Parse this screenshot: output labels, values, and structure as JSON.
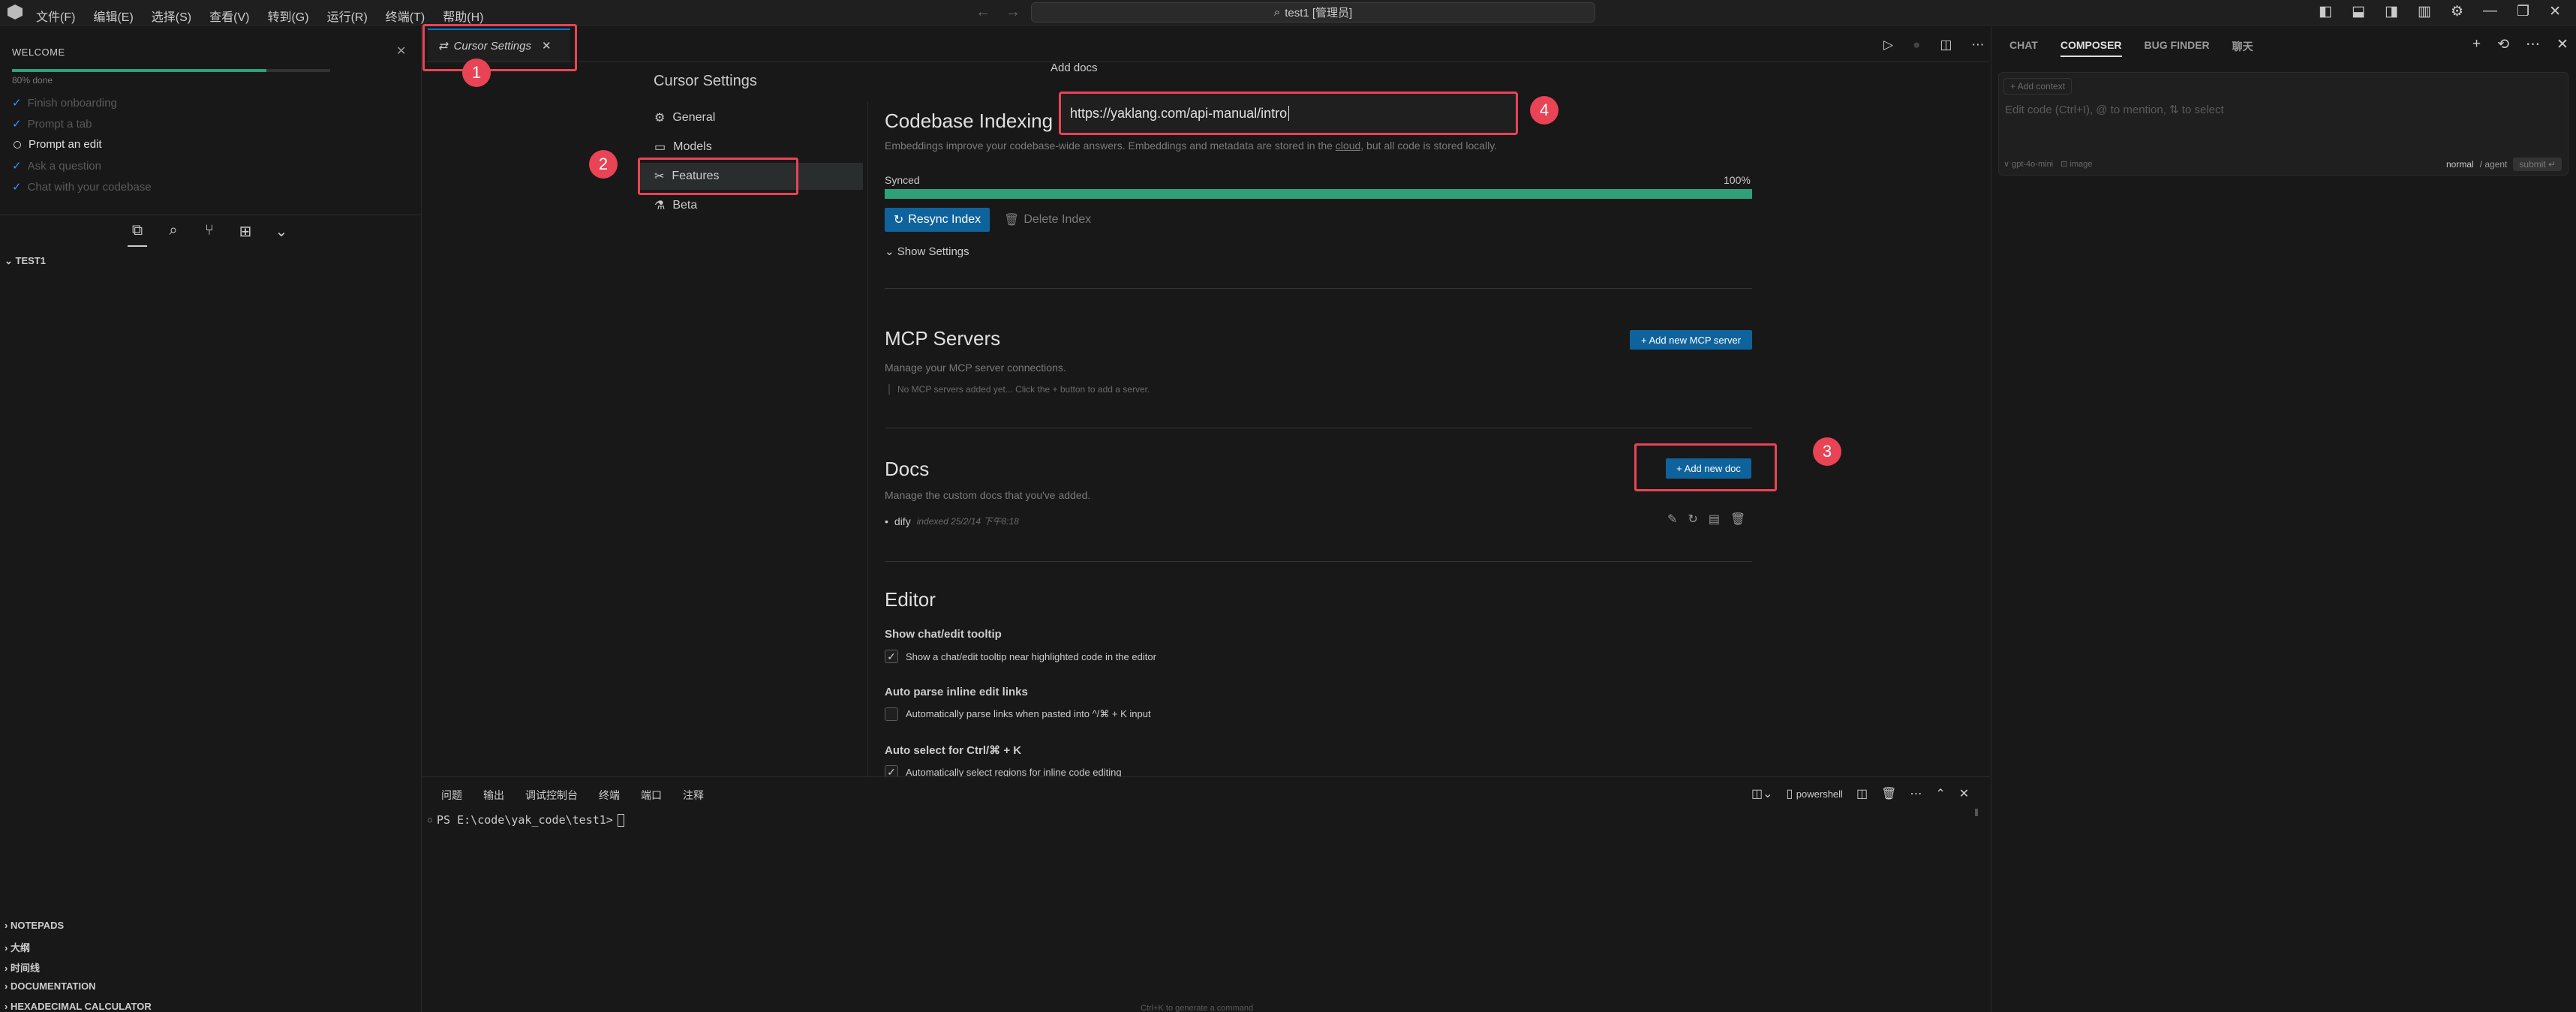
{
  "menu": [
    "文件(F)",
    "编辑(E)",
    "选择(S)",
    "查看(V)",
    "转到(G)",
    "运行(R)",
    "终端(T)",
    "帮助(H)"
  ],
  "command_center": {
    "label": "test1 [管理员]"
  },
  "welcome": {
    "title": "WELCOME",
    "progress_label": "80% done",
    "progress_fraction": 0.8,
    "steps": [
      {
        "label": "Finish onboarding",
        "done": true
      },
      {
        "label": "Prompt a tab",
        "done": true
      },
      {
        "label": "Prompt an edit",
        "done": false
      },
      {
        "label": "Ask a question",
        "done": true
      },
      {
        "label": "Chat with your codebase",
        "done": true
      }
    ]
  },
  "explorer": {
    "root": "TEST1"
  },
  "bottom_sections": [
    "NOTEPADS",
    "大纲",
    "时间线",
    "DOCUMENTATION",
    "HEXADECIMAL CALCULATOR"
  ],
  "editor_tab": {
    "label": "Cursor Settings"
  },
  "settings": {
    "title": "Cursor Settings",
    "nav": [
      "General",
      "Models",
      "Features",
      "Beta"
    ],
    "codebase": {
      "title": "Codebase Indexing",
      "desc_before": "Embeddings improve your codebase-wide answers. Embeddings and metadata are stored in the ",
      "desc_link": "cloud",
      "desc_after": ", but all code is stored locally.",
      "status": "Synced",
      "percent_label": "100%",
      "progress": 1.0,
      "resync": "Resync Index",
      "delete": "Delete Index",
      "show_settings": "Show Settings"
    },
    "mcp": {
      "title": "MCP Servers",
      "desc": "Manage your MCP server connections.",
      "add": "+ Add new MCP server",
      "empty": "No MCP servers added yet... Click the + button to add a server."
    },
    "docs": {
      "title": "Docs",
      "desc": "Manage the custom docs that you've added.",
      "add": "+ Add new doc",
      "items": [
        {
          "name": "dify",
          "meta": "indexed 25/2/14 下午8:18"
        }
      ]
    },
    "editor": {
      "title": "Editor",
      "opt1_title": "Show chat/edit tooltip",
      "opt1_label": "Show a chat/edit tooltip near highlighted code in the editor",
      "opt1_checked": true,
      "opt2_title": "Auto parse inline edit links",
      "opt2_label": "Automatically parse links when pasted into ^/⌘ + K input",
      "opt2_checked": false,
      "opt3_title": "Auto select for Ctrl/⌘ + K",
      "opt3_label": "Automatically select regions for inline code editing",
      "opt3_checked": true
    }
  },
  "add_docs_popup": {
    "tooltip": "Add docs",
    "url": "https://yaklang.com/api-manual/intro"
  },
  "annotations": [
    "1",
    "2",
    "3",
    "4"
  ],
  "panel": {
    "tabs": [
      "问题",
      "输出",
      "调试控制台",
      "终端",
      "端口",
      "注释"
    ],
    "shell": "powershell",
    "prompt": "PS E:\\code\\yak_code\\test1>",
    "hint": "Ctrl+K to generate a command"
  },
  "aux": {
    "tabs": [
      "CHAT",
      "COMPOSER",
      "BUG FINDER",
      "聊天"
    ],
    "active_tab": "COMPOSER",
    "add_context": "+ Add context",
    "placeholder": "Edit code (Ctrl+I), @ to mention, ⇅ to select",
    "model": "∨ gpt-4o-mini",
    "image": "⊡ image",
    "mode_normal": "normal",
    "mode_agent": "/ agent",
    "submit": "submit ↵"
  },
  "colors": {
    "accent": "#0e639c",
    "progress": "#2ea179",
    "highlight": "#e94356"
  }
}
